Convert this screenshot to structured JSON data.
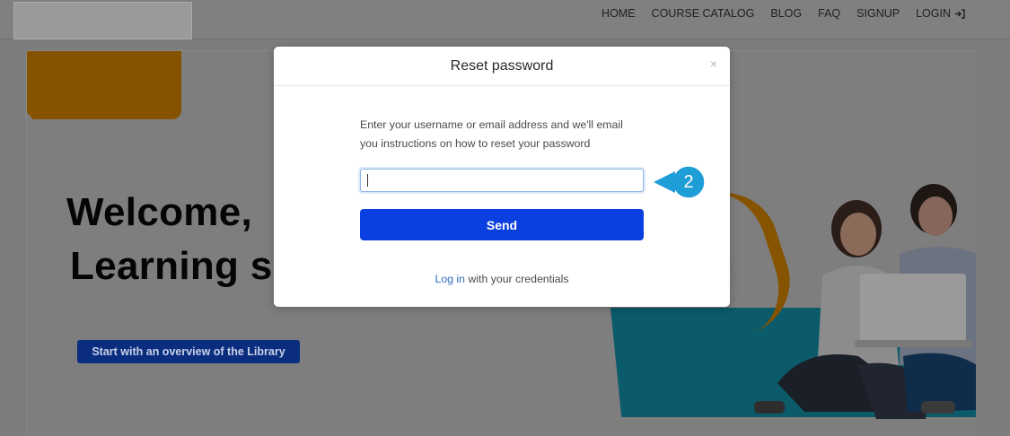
{
  "nav": {
    "items": [
      "HOME",
      "COURSE CATALOG",
      "BLOG",
      "FAQ",
      "SIGNUP"
    ],
    "login_label": "LOGIN"
  },
  "hero": {
    "welcome_line1": "Welcome,",
    "welcome_line2": "Learning s",
    "overview_button": "Start with an overview of the Library"
  },
  "modal": {
    "title": "Reset password",
    "close_glyph": "×",
    "instructions_line1": "Enter your username or email address and we'll email",
    "instructions_line2": "you instructions on how to reset your password",
    "input_value": "",
    "send_label": "Send",
    "login_link": "Log in",
    "login_suffix": " with your credentials"
  },
  "callout": {
    "step_number": "2",
    "color": "#1e9ed6"
  },
  "colors": {
    "overlay": "#7d7d7d",
    "send_button": "#0b40e0",
    "link": "#2a6ebd"
  },
  "icons": {
    "login": "login-arrow-icon"
  }
}
